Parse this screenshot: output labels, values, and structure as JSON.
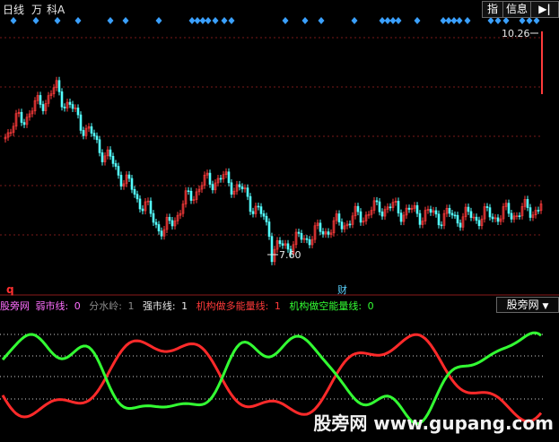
{
  "toolbar": {
    "period_label": "日线",
    "unit_label": "万",
    "ka_label": "科A",
    "index_button": "指",
    "info_button": "信息",
    "arrow_icon": "play-arrow-icon",
    "dropdown_icon": "chevron-down-icon"
  },
  "price_chart": {
    "high_label": "10.26",
    "low_label": "7.60",
    "cai_label": "财",
    "q_label": "q",
    "colors": {
      "up": "#ff3b3b",
      "down": "#54ffff",
      "marker": "#3aa0ff",
      "grid": "#7a1a1a"
    }
  },
  "indicator": {
    "name": "股旁网",
    "weak_label": "弱市线:",
    "weak_value": "0",
    "fen_label": "分水岭:",
    "fen_value": "1",
    "strong_label": "强市线:",
    "strong_value": "1",
    "long_label": "机构做多能量线:",
    "long_value": "1",
    "short_label": "机构做空能量线:",
    "short_value": "0",
    "tab_label": "股旁网",
    "colors": {
      "long": "#ff2a2a",
      "short": "#33ff33",
      "grid": "#cfcfcf"
    }
  },
  "watermark": "股旁网 www.gupang.com"
}
